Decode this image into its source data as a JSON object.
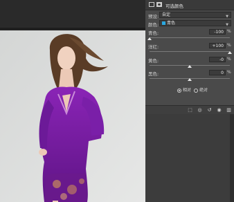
{
  "panel": {
    "title": "可选颜色",
    "preset_label": "预设:",
    "preset_value": "自定",
    "colors_label": "颜色:",
    "colors_value": "青色",
    "colors_swatch": "#2aa8e0",
    "sliders": [
      {
        "label": "青色:",
        "value": "-100",
        "unit": "%",
        "level": 0.0
      },
      {
        "label": "洋红:",
        "value": "+100",
        "unit": "%",
        "level": 1.0
      },
      {
        "label": "黄色:",
        "value": "-0",
        "unit": "%",
        "level": 0.5
      },
      {
        "label": "黑色:",
        "value": "0",
        "unit": "%",
        "level": 0.5
      }
    ],
    "method": {
      "relative_label": "相对",
      "absolute_label": "绝对",
      "selected": "relative"
    },
    "footer_icons": [
      "clip-to-layer-icon",
      "visibility-eye-icon",
      "reset-icon",
      "view-previous-icon",
      "trash-icon"
    ]
  },
  "photo": {
    "dress_color": "#7b1fa2",
    "wall_color": "#d9dcdb"
  }
}
